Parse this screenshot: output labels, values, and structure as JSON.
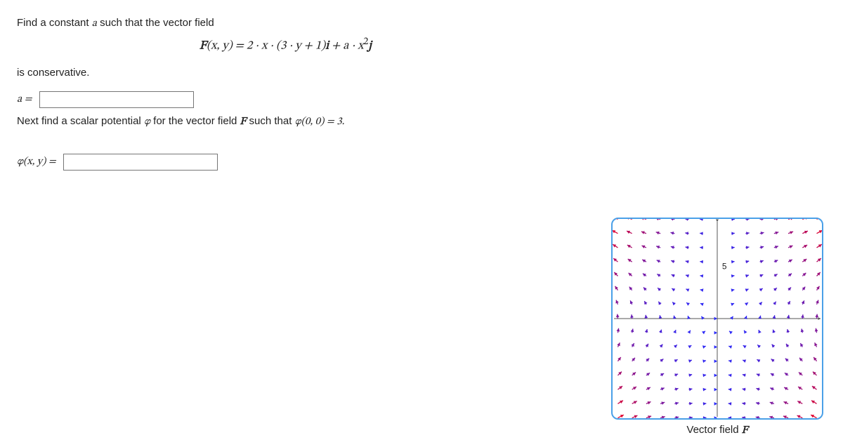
{
  "q1_intro": "Find a constant ",
  "q1_tail": " such that the vector field",
  "eq_lhs": "F",
  "eq_args": "(x, y) = 2 · x · (3 · y + 1)",
  "eq_i": "i",
  "eq_plus": " + a · x",
  "eq_sq": "2",
  "eq_j": "j",
  "is_cons": "is conservative.",
  "a_label": "a =",
  "q2_pre": "Next find a scalar potential ",
  "phi_sym": "φ",
  "q2_mid": " for the vector field ",
  "F_sym": "F",
  "q2_post1": " such that ",
  "phi_cond": "φ(0, 0) = 3.",
  "phi_label": "φ(x, y)  =",
  "tick5": "5",
  "caption_pre": "Vector field ",
  "caption_F": "F",
  "chart_data": {
    "type": "heatmap",
    "title": "Vector field F",
    "xlabel": "",
    "ylabel": "",
    "xlim": [
      -7,
      7
    ],
    "ylim": [
      -7,
      7
    ],
    "ticks_labeled": [
      "5"
    ],
    "description": "Quiver/vector-field plot of F(x,y) on roughly [-7,7]×[-7,7], arrows colored on a blue→red gradient by magnitude, converging pattern with axes drawn."
  }
}
